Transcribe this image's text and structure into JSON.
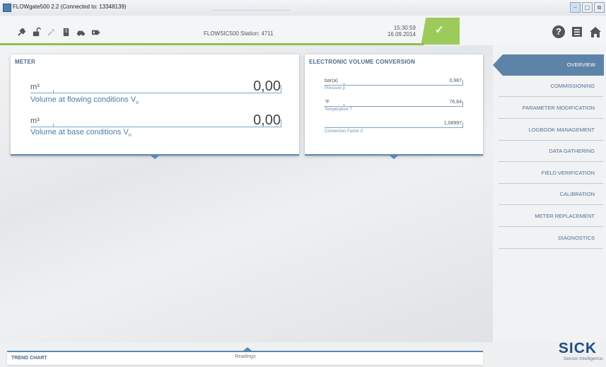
{
  "window": {
    "title": "FLOWgate500 2.2 (Connected to: 13348139)",
    "controls": {
      "minimize": "–",
      "maximize": "▢",
      "restore": "⧉"
    }
  },
  "toolbar": {
    "icons": [
      "plug-icon",
      "unlock-icon",
      "wrench-icon",
      "document-icon",
      "car-icon",
      "battery-icon"
    ],
    "station": "FLOWSIC500 Station: 4711",
    "time": "15:30:59",
    "date": "16.09.2014",
    "status_icon": "checkmark-icon",
    "status_symbol": "✓",
    "help_symbol": "?",
    "status_color": "#9ccb5c",
    "accent_color": "#5a87b3"
  },
  "meter": {
    "title": "METER",
    "rows": [
      {
        "unit": "m³",
        "value": "0,00",
        "label": "Volume at flowing conditions V",
        "sub": "o"
      },
      {
        "unit": "m³",
        "value": "0,00",
        "label": "Volume at base conditions V",
        "sub": "n"
      }
    ]
  },
  "evc": {
    "title": "ELECTRONIC VOLUME CONVERSION",
    "rows": [
      {
        "unit": "bar(a)",
        "value": "0,987",
        "label": "Pressure p"
      },
      {
        "unit": "°F",
        "value": "76,64",
        "label": "Temperature T"
      },
      {
        "unit": "",
        "value": "1,08997",
        "label": "Conversion Factor C"
      }
    ]
  },
  "nav": {
    "items": [
      {
        "label": "OVERVIEW",
        "active": true
      },
      {
        "label": "COMMISSIONING",
        "active": false
      },
      {
        "label": "PARAMETER MODIFICATION",
        "active": false
      },
      {
        "label": "LOGBOOK MANAGEMENT",
        "active": false
      },
      {
        "label": "DATA GATHERING",
        "active": false
      },
      {
        "label": "FIELD VERIFICATION",
        "active": false
      },
      {
        "label": "CALIBRATION",
        "active": false
      },
      {
        "label": "METER REPLACEMENT",
        "active": false
      },
      {
        "label": "DIAGNOSTICS",
        "active": false
      }
    ]
  },
  "footer": {
    "trend_chart": "TREND CHART",
    "readings": "Readings"
  },
  "logo": {
    "brand": "SICK",
    "tagline": "Sensor Intelligence."
  }
}
